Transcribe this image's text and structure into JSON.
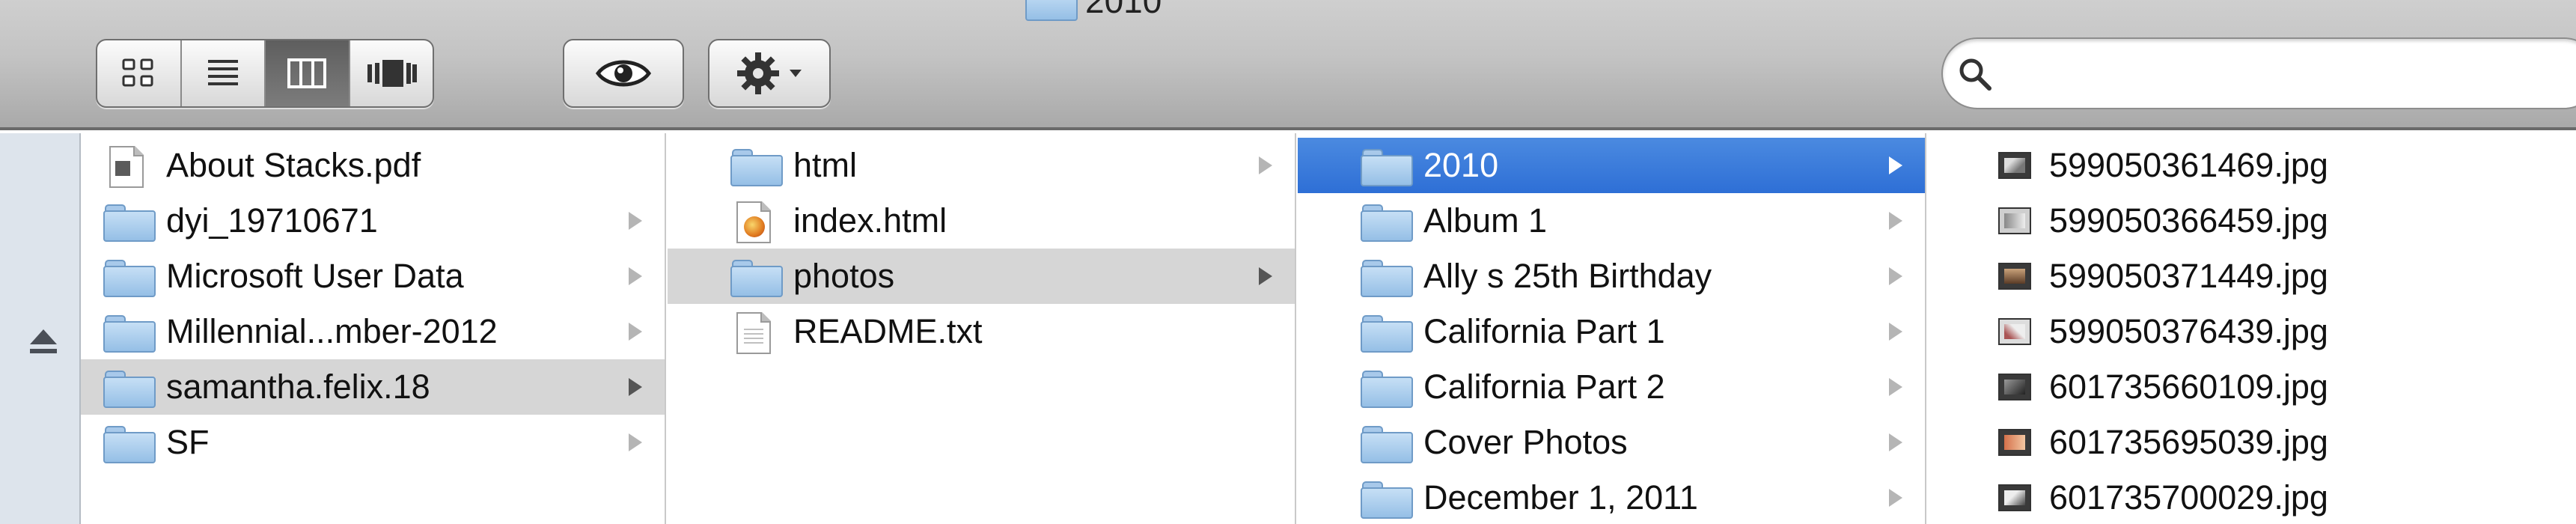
{
  "window": {
    "title": "2010"
  },
  "toolbar": {
    "view_modes": [
      {
        "name": "icon-view",
        "active": false
      },
      {
        "name": "list-view",
        "active": false
      },
      {
        "name": "column-view",
        "active": true
      },
      {
        "name": "cover-flow-view",
        "active": false
      }
    ],
    "quick_look_icon": "eye-icon",
    "action_icon": "gear-icon",
    "search": {
      "value": "",
      "placeholder": ""
    }
  },
  "sidebar": {
    "eject_icon": "eject-icon"
  },
  "columns": [
    {
      "items": [
        {
          "label": "About Stacks.pdf",
          "type": "pdf",
          "has_children": false,
          "selected": false
        },
        {
          "label": "dyi_19710671",
          "type": "folder",
          "has_children": true,
          "selected": false
        },
        {
          "label": "Microsoft User Data",
          "type": "folder",
          "has_children": true,
          "selected": false
        },
        {
          "label": "Millennial...mber-2012",
          "type": "folder",
          "has_children": true,
          "selected": false
        },
        {
          "label": "samantha.felix.18",
          "type": "folder",
          "has_children": true,
          "selected": true
        },
        {
          "label": "SF",
          "type": "folder",
          "has_children": true,
          "selected": false
        }
      ]
    },
    {
      "items": [
        {
          "label": "html",
          "type": "folder",
          "has_children": true,
          "selected": false
        },
        {
          "label": "index.html",
          "type": "html",
          "has_children": false,
          "selected": false
        },
        {
          "label": "photos",
          "type": "folder",
          "has_children": true,
          "selected": true
        },
        {
          "label": "README.txt",
          "type": "text",
          "has_children": false,
          "selected": false
        }
      ]
    },
    {
      "items": [
        {
          "label": "2010",
          "type": "folder",
          "has_children": true,
          "selected": true
        },
        {
          "label": "Album 1",
          "type": "folder",
          "has_children": true,
          "selected": false
        },
        {
          "label": "Ally s 25th Birthday",
          "type": "folder",
          "has_children": true,
          "selected": false
        },
        {
          "label": "California Part 1",
          "type": "folder",
          "has_children": true,
          "selected": false
        },
        {
          "label": "California Part 2",
          "type": "folder",
          "has_children": true,
          "selected": false
        },
        {
          "label": "Cover Photos",
          "type": "folder",
          "has_children": true,
          "selected": false
        },
        {
          "label": "December 1, 2011",
          "type": "folder",
          "has_children": true,
          "selected": false
        }
      ]
    },
    {
      "items": [
        {
          "label": "599050361469.jpg",
          "type": "jpg"
        },
        {
          "label": "599050366459.jpg",
          "type": "jpg"
        },
        {
          "label": "599050371449.jpg",
          "type": "jpg"
        },
        {
          "label": "599050376439.jpg",
          "type": "jpg"
        },
        {
          "label": "601735660109.jpg",
          "type": "jpg"
        },
        {
          "label": "601735695039.jpg",
          "type": "jpg"
        },
        {
          "label": "601735700029.jpg",
          "type": "jpg"
        }
      ]
    }
  ]
}
